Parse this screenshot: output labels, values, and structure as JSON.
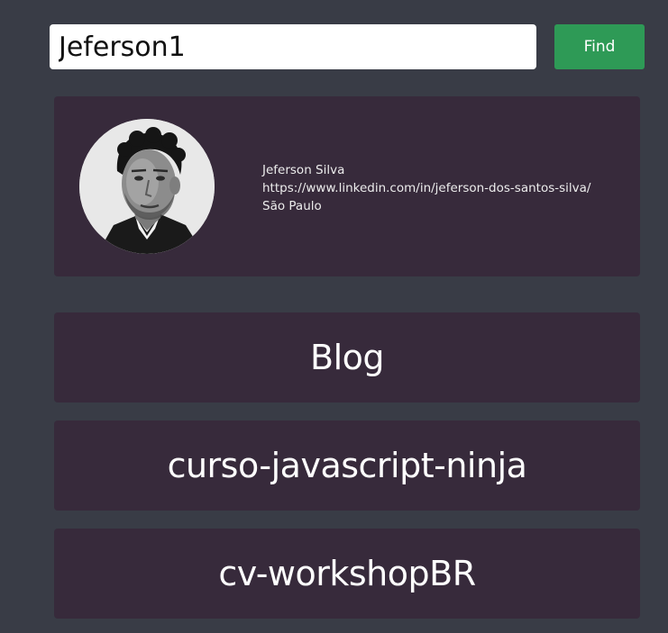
{
  "search": {
    "value": "Jeferson1",
    "button_label": "Find"
  },
  "profile": {
    "avatar_icon": "user-photo",
    "name": "Jeferson Silva",
    "url": "https://www.linkedin.com/in/jeferson-dos-santos-silva/",
    "location": "São Paulo"
  },
  "repos": [
    {
      "name": "Blog"
    },
    {
      "name": "curso-javascript-ninja"
    },
    {
      "name": "cv-workshopBR"
    }
  ],
  "colors": {
    "background": "#393c46",
    "card": "#372a3b",
    "accent": "#2e9a56"
  }
}
